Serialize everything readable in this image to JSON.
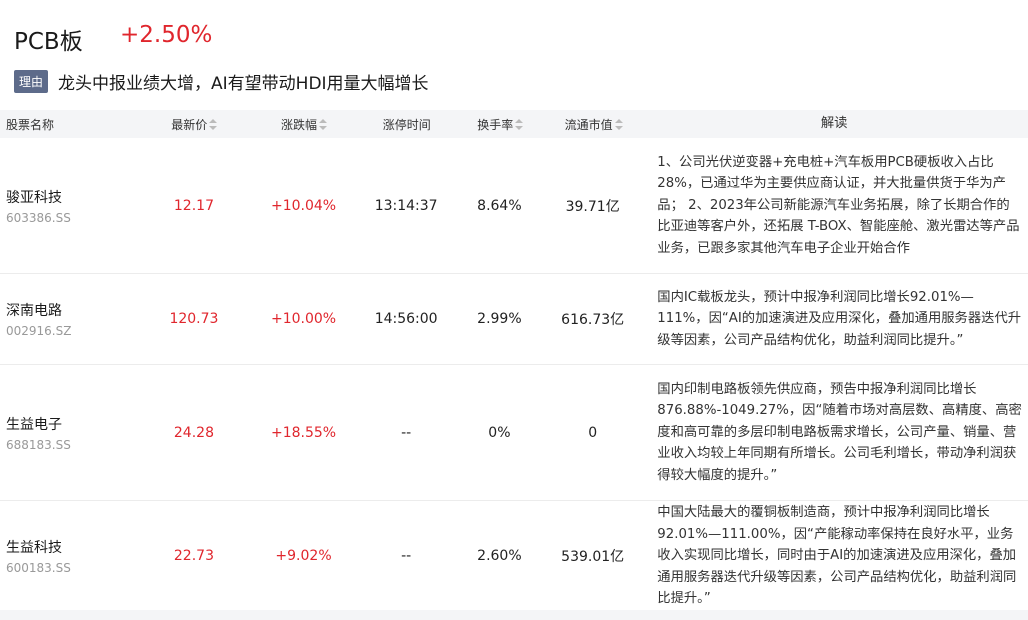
{
  "board": {
    "name": "PCB板",
    "change": "+2.50%"
  },
  "reason": {
    "badge": "理由",
    "text": "龙头中报业绩大增，AI有望带动HDI用量大幅增长"
  },
  "columns": [
    "股票名称",
    "最新价",
    "涨跌幅",
    "涨停时间",
    "换手率",
    "流通市值",
    "解读"
  ],
  "rows": [
    {
      "name": "骏亚科技",
      "code": "603386.SS",
      "price": "12.17",
      "change": "+10.04%",
      "limit_time": "13:14:37",
      "turnover": "8.64%",
      "cap": "39.71亿",
      "desc": "1、公司光伏逆变器+充电桩+汽车板用PCB硬板收入占比28%，已通过华为主要供应商认证，并大批量供货于华为产品； 2、2023年公司新能源汽车业务拓展，除了长期合作的比亚迪等客户外，还拓展 T-BOX、智能座舱、激光雷达等产品业务，已跟多家其他汽车电子企业开始合作"
    },
    {
      "name": "深南电路",
      "code": "002916.SZ",
      "price": "120.73",
      "change": "+10.00%",
      "limit_time": "14:56:00",
      "turnover": "2.99%",
      "cap": "616.73亿",
      "desc": "国内IC载板龙头，预计中报净利润同比增长92.01%—111%，因“AI的加速演进及应用深化，叠加通用服务器迭代升级等因素，公司产品结构优化，助益利润同比提升。”"
    },
    {
      "name": "生益电子",
      "code": "688183.SS",
      "price": "24.28",
      "change": "+18.55%",
      "limit_time": "--",
      "turnover": "0%",
      "cap": "0",
      "desc": "国内印制电路板领先供应商，预告中报净利润同比增长876.88%-1049.27%，因“随着市场对高层数、高精度、高密度和高可靠的多层印制电路板需求增长，公司产量、销量、营业收入均较上年同期有所增长。公司毛利增长，带动净利润获得较大幅度的提升。”"
    },
    {
      "name": "生益科技",
      "code": "600183.SS",
      "price": "22.73",
      "change": "+9.02%",
      "limit_time": "--",
      "turnover": "2.60%",
      "cap": "539.01亿",
      "desc": "中国大陆最大的覆铜板制造商，预计中报净利润同比增长92.01%—111.00%，因“产能稼动率保持在良好水平，业务收入实现同比增长，同时由于AI的加速演进及应用深化，叠加通用服务器迭代升级等因素，公司产品结构优化，助益利润同比提升。”"
    }
  ]
}
